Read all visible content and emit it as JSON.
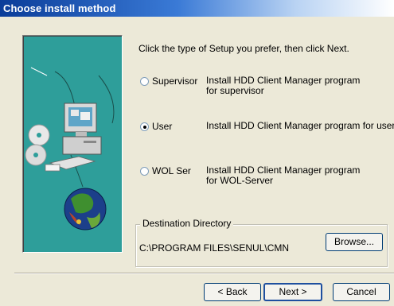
{
  "window": {
    "title": "Choose install method"
  },
  "content": {
    "instruction": "Click the type of Setup you prefer, then click Next."
  },
  "options": [
    {
      "label": "Supervisor",
      "description": "Install HDD Client Manager program for supervisor",
      "selected": false
    },
    {
      "label": "User",
      "description": "Install HDD Client Manager program for user",
      "selected": true
    },
    {
      "label": "WOL Ser",
      "description": "Install HDD Client Manager program for WOL-Server",
      "selected": false
    }
  ],
  "destination": {
    "group_label": "Destination Directory",
    "path": "C:\\PROGRAM FILES\\SENUL\\CMN",
    "browse_label": "Browse..."
  },
  "buttons": {
    "back": "< Back",
    "next": "Next >",
    "cancel": "Cancel"
  },
  "colors": {
    "titlebar_start": "#0b3d99",
    "art_background": "#2e9e9a",
    "dialog_background": "#ece9d8"
  }
}
